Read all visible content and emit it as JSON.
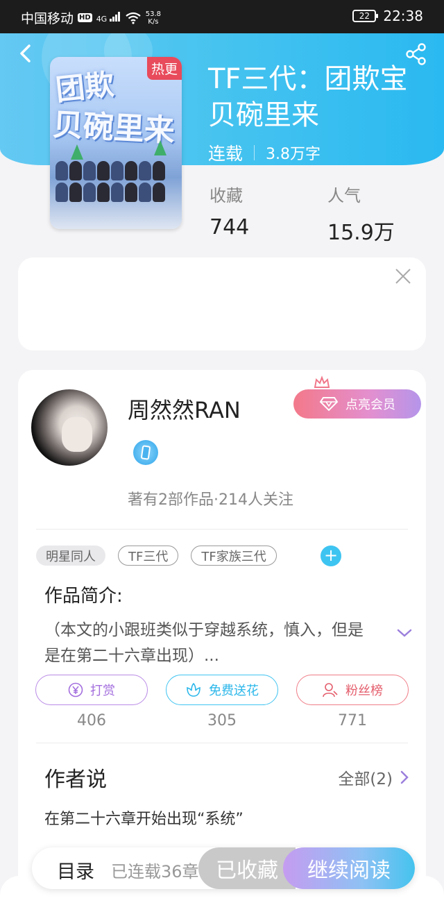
{
  "status_bar": {
    "carrier": "中国移动",
    "hd": "HD",
    "signal": "4G",
    "net_speed_value": "53.8",
    "net_speed_unit": "K/s",
    "battery": "22",
    "time": "22:38"
  },
  "header": {
    "cover_tag": "热更",
    "cover_text_line1": "团欺",
    "cover_text_line2": "贝碗里来",
    "title": "TF三代：团欺宝贝碗里来",
    "status": "连载",
    "word_count": "3.8万字",
    "stats": [
      {
        "label": "收藏",
        "value": "744"
      },
      {
        "label": "人气",
        "value": "15.9万"
      }
    ]
  },
  "author": {
    "name": "周然然RAN",
    "vip_label": "点亮会员",
    "works_info": "著有2部作品·214人关注"
  },
  "tags": [
    "明星同人",
    "TF三代",
    "TF家族三代"
  ],
  "intro": {
    "title": "作品简介:",
    "text": "（本文的小跟班类似于穿越系统，慎入，但是是在第二十六章出现）..."
  },
  "actions": [
    {
      "label": "打赏",
      "count": "406"
    },
    {
      "label": "免费送花",
      "count": "305"
    },
    {
      "label": "粉丝榜",
      "count": "771"
    }
  ],
  "author_says": {
    "title": "作者说",
    "all_label": "全部(2)",
    "latest": "在第二十六章开始出现“系统”"
  },
  "bottom_bar": {
    "toc": "目录",
    "serial_info": "已连载36章",
    "collected": "已收藏",
    "continue": "继续阅读"
  },
  "colors": {
    "header_blue": "#46c3ef",
    "vip_pink": "#f3798a",
    "tip_purple": "#a36ede",
    "flower_blue": "#2bb7ea",
    "fans_red": "#e45e6c"
  },
  "icons": [
    "back-icon",
    "share-icon",
    "close-icon",
    "crown-icon",
    "diamond-icon",
    "phone-badge-icon",
    "plus-icon",
    "chevron-down-icon",
    "yen-icon",
    "flower-icon",
    "user-icon",
    "chevron-right-icon"
  ]
}
